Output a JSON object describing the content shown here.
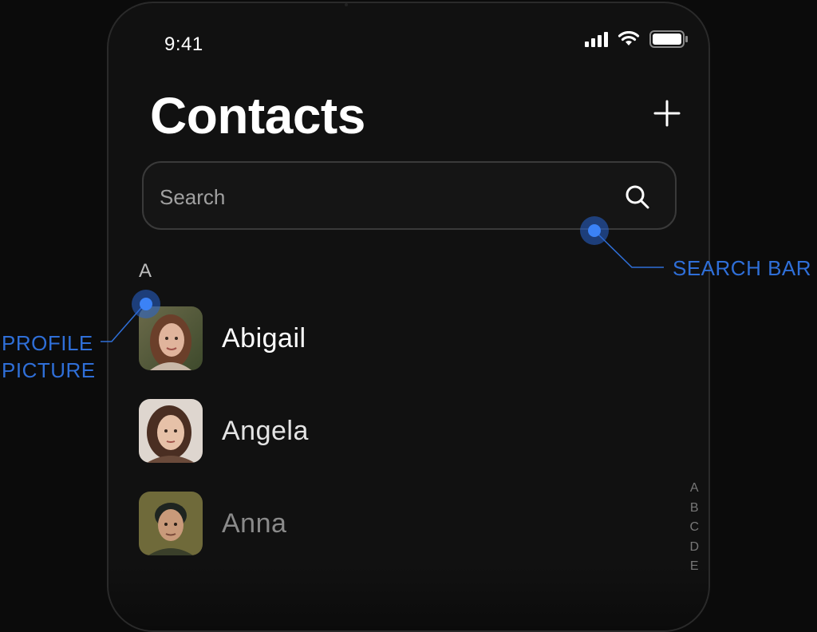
{
  "status_bar": {
    "time": "9:41"
  },
  "header": {
    "title": "Contacts",
    "add_label": "+"
  },
  "search": {
    "placeholder": "Search"
  },
  "sections": [
    {
      "letter": "A",
      "contacts": [
        {
          "name": "Abigail",
          "color": "#ffffff"
        },
        {
          "name": "Angela",
          "color": "#e4e4e4"
        },
        {
          "name": "Anna",
          "color": "#8a8a8a"
        }
      ]
    }
  ],
  "index_letters": [
    "A",
    "B",
    "C",
    "D",
    "E"
  ],
  "annotations": {
    "search_bar": "SEARCH BAR",
    "profile_picture_line1": "PROFILE",
    "profile_picture_line2": "PICTURE",
    "accent": "#2f6fd8"
  },
  "icons": {
    "add": "plus-icon",
    "search": "search-icon",
    "signal": "cellular-signal-icon",
    "wifi": "wifi-icon",
    "battery": "battery-icon"
  }
}
